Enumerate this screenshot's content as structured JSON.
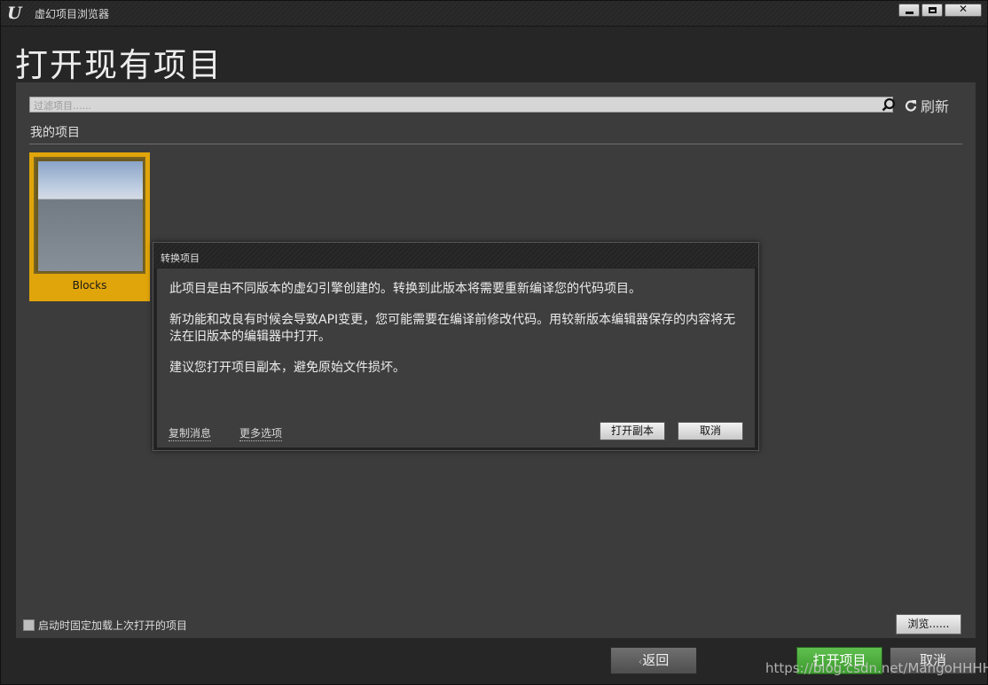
{
  "window": {
    "title": "虚幻项目浏览器"
  },
  "page": {
    "title": "打开现有项目"
  },
  "search": {
    "placeholder": "过滤项目......"
  },
  "refresh_label": "刷新",
  "section_label": "我的项目",
  "projects": [
    {
      "name": "Blocks"
    }
  ],
  "footer": {
    "autoload_label": "启动时固定加载上次打开的项目",
    "browse_label": "浏览......"
  },
  "actions": {
    "back_label": "返回",
    "open_label": "打开项目",
    "cancel_label": "取消"
  },
  "watermark": "https://blog.csdn.net/MangoHHHH",
  "dialog": {
    "title": "转换项目",
    "message_1": "此项目是由不同版本的虚幻引擎创建的。转换到此版本将需要重新编译您的代码项目。",
    "message_2": "新功能和改良有时候会导致API变更，您可能需要在编译前修改代码。用较新版本编辑器保存的内容将无法在旧版本的编辑器中打开。",
    "message_3": "建议您打开项目副本，避免原始文件损坏。",
    "copy_message_label": "复制消息",
    "more_options_label": "更多选项",
    "open_copy_label": "打开副本",
    "cancel_label": "取消"
  },
  "colors": {
    "accent_green": "#4caf3a",
    "selection_gold": "#e0a50a"
  }
}
